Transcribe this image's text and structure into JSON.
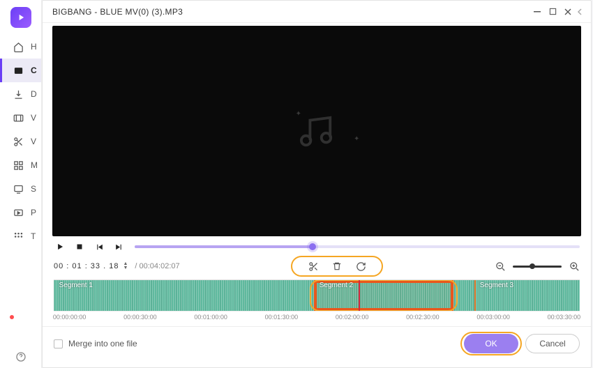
{
  "window": {
    "title": "BIGBANG - BLUE MV(0) (3).MP3"
  },
  "sidebar": {
    "items": [
      {
        "icon": "home",
        "label": "H"
      },
      {
        "icon": "convert",
        "label": "C"
      },
      {
        "icon": "download",
        "label": "D"
      },
      {
        "icon": "video",
        "label": "V"
      },
      {
        "icon": "cut",
        "label": "V"
      },
      {
        "icon": "merge",
        "label": "M"
      },
      {
        "icon": "screen",
        "label": "S"
      },
      {
        "icon": "play",
        "label": "P"
      },
      {
        "icon": "apps",
        "label": "T"
      }
    ]
  },
  "playback": {
    "current_time": "00 : 01 : 33 . 18",
    "duration": "/ 00:04:02:07",
    "progress_pct": 40
  },
  "segments": {
    "labels": [
      "Segment 1",
      "Segment 2",
      "Segment 3"
    ],
    "divider_pcts": [
      49.5,
      80
    ],
    "selection": {
      "start_pct": 49.5,
      "end_pct": 76
    },
    "playhead_pct": 58
  },
  "ruler": {
    "ticks": [
      "00:00:00:00",
      "00:00:30:00",
      "00:01:00:00",
      "00:01:30:00",
      "00:02:00:00",
      "00:02:30:00",
      "00:03:00:00",
      "00:03:30:00"
    ]
  },
  "footer": {
    "merge_label": "Merge into one file",
    "ok_label": "OK",
    "cancel_label": "Cancel"
  }
}
